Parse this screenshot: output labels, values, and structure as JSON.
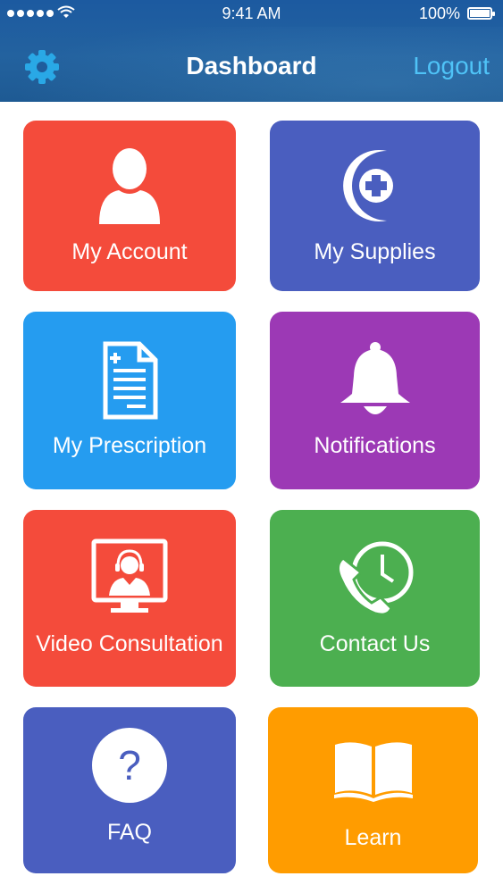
{
  "status_bar": {
    "time": "9:41 AM",
    "battery": "100%"
  },
  "header": {
    "title": "Dashboard",
    "logout_label": "Logout",
    "settings_icon": "gear-icon"
  },
  "colors": {
    "header": "#1f5c9c",
    "logout": "#4fc3f7",
    "red": "#f44b3b",
    "indigo": "#4a5ebf",
    "blue": "#259cf0",
    "purple": "#9c39b5",
    "green": "#4caf50",
    "orange": "#ff9c00"
  },
  "tiles": [
    {
      "label": "My Account",
      "icon": "user-icon"
    },
    {
      "label": "My Supplies",
      "icon": "medical-cross-icon"
    },
    {
      "label": "My Prescription",
      "icon": "prescription-document-icon"
    },
    {
      "label": "Notifications",
      "icon": "bell-icon"
    },
    {
      "label": "Video Consultation",
      "icon": "video-consultation-icon"
    },
    {
      "label": "Contact Us",
      "icon": "phone-clock-icon"
    },
    {
      "label": "FAQ",
      "icon": "question-icon"
    },
    {
      "label": "Learn",
      "icon": "book-icon"
    }
  ]
}
